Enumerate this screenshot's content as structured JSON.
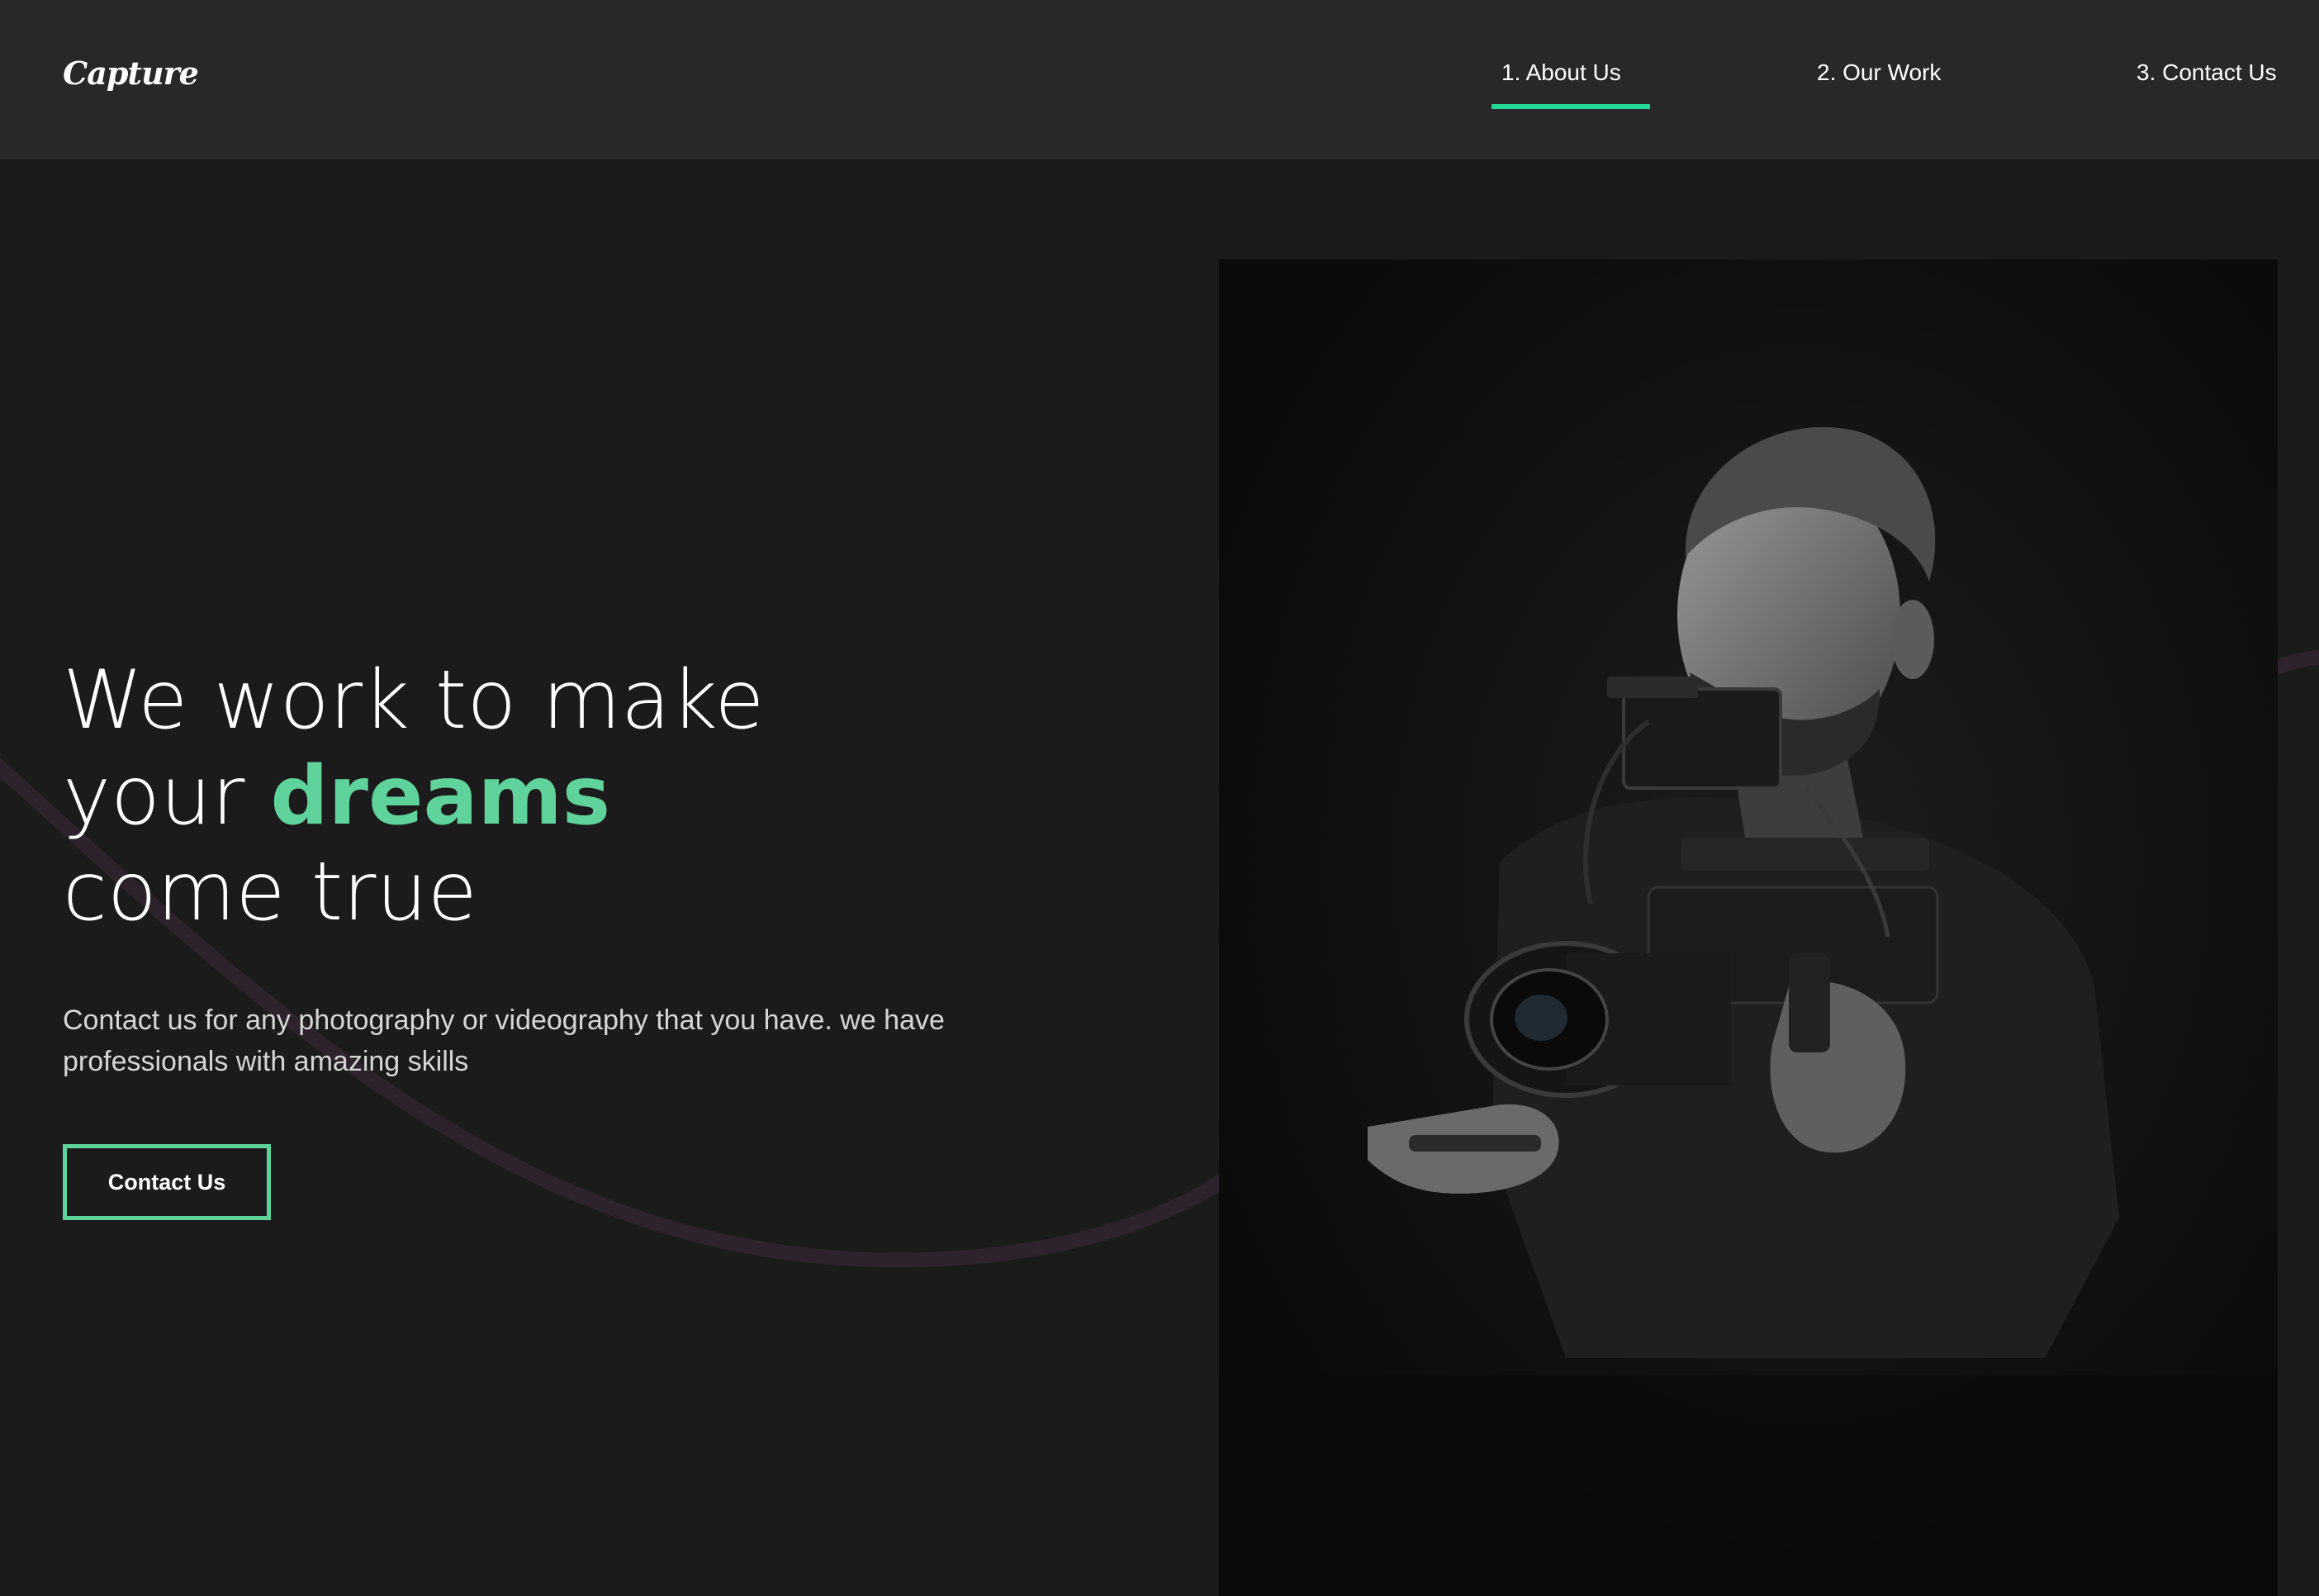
{
  "header": {
    "logo": "Capture",
    "nav": [
      {
        "label": "1. About Us",
        "active": true
      },
      {
        "label": "2. Our Work",
        "active": false
      },
      {
        "label": "3. Contact Us",
        "active": false
      }
    ]
  },
  "hero": {
    "headline_line1": "We work to make",
    "headline_line2_prefix": "your",
    "headline_line2_accent": "dreams",
    "headline_line3": "come true",
    "description": "Contact us for any photography or videography that you have. we have professionals with amazing skills",
    "cta_label": "Contact Us"
  },
  "colors": {
    "background": "#1b1b1b",
    "header_bg": "#282828",
    "accent": "#5fd39b",
    "wave": "#2e222c"
  },
  "image": {
    "subject": "videographer-with-camera-rig-photo"
  }
}
